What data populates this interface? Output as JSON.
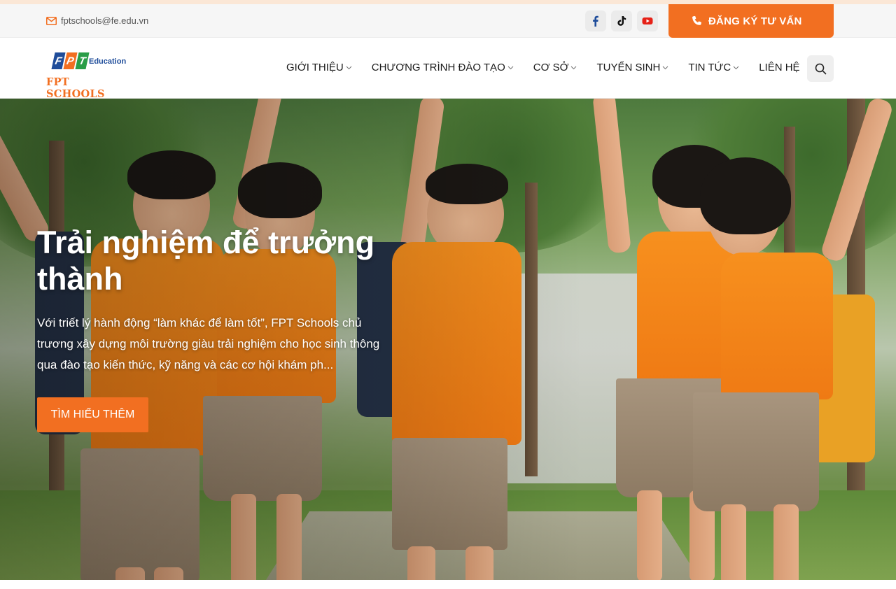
{
  "topbar": {
    "email": "fptschools@fe.edu.vn",
    "socials": [
      {
        "icon": "facebook-icon",
        "color": "#1e4c9a"
      },
      {
        "icon": "tiktok-icon",
        "color": "#111111"
      },
      {
        "icon": "youtube-icon",
        "color": "#e62117"
      }
    ],
    "register_label": "ĐĂNG KÝ TƯ VẤN"
  },
  "header": {
    "logo": {
      "letters": [
        "F",
        "P",
        "T"
      ],
      "letter_colors": [
        "#1e4c9a",
        "#f26f21",
        "#2a9d48"
      ],
      "education": "Education",
      "schools": "FPT SCHOOLS"
    },
    "nav": [
      {
        "label": "GIỚI THIỆU",
        "has_dropdown": true
      },
      {
        "label": "CHƯƠNG TRÌNH ĐÀO TẠO",
        "has_dropdown": true
      },
      {
        "label": "CƠ SỞ",
        "has_dropdown": true
      },
      {
        "label": "TUYỂN SINH",
        "has_dropdown": true
      },
      {
        "label": "TIN TỨC",
        "has_dropdown": true
      },
      {
        "label": "LIÊN HỆ",
        "has_dropdown": false
      }
    ],
    "search_icon": "search-icon"
  },
  "hero": {
    "title": "Trải nghiệm để trưởng thành",
    "description": "Với triết lý hành động “làm khác để làm tốt”, FPT Schools chủ trương xây dựng môi trường giàu trải nghiệm cho học sinh thông qua đào tạo kiến thức, kỹ năng và các cơ hội khám ph...",
    "cta_label": "TÌM HIỂU THÊM"
  },
  "colors": {
    "accent": "#f26f21",
    "brand_blue": "#1e4c9a",
    "brand_green": "#2a9d48"
  }
}
